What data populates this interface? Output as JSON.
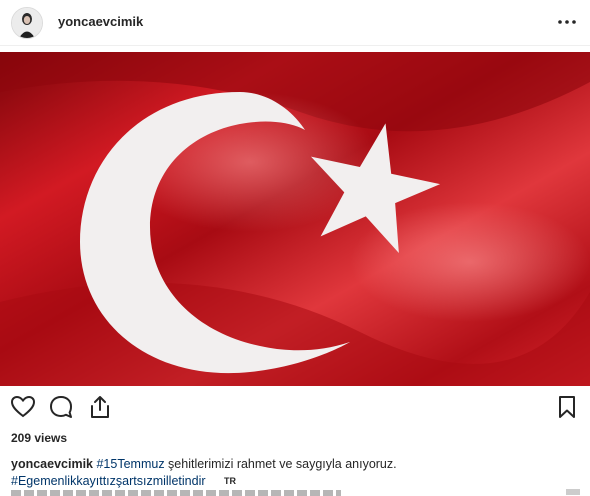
{
  "post": {
    "username": "yoncaevcimik",
    "views_text": "209 views",
    "caption": {
      "username": "yoncaevcimik",
      "hashtag_1": "#15Temmuz",
      "text": " şehitlerimizi rahmet ve saygıyla anıyoruz.",
      "hashtag_2": "#Egemenlikkayıttızşartsızmilletindir",
      "lang_badge": "TR"
    }
  },
  "colors": {
    "flag_red": "#c4101a",
    "flag_white": "#f2efef",
    "hashtag": "#003569"
  },
  "icons": [
    "more-icon",
    "heart-icon",
    "comment-icon",
    "share-icon",
    "bookmark-icon"
  ]
}
